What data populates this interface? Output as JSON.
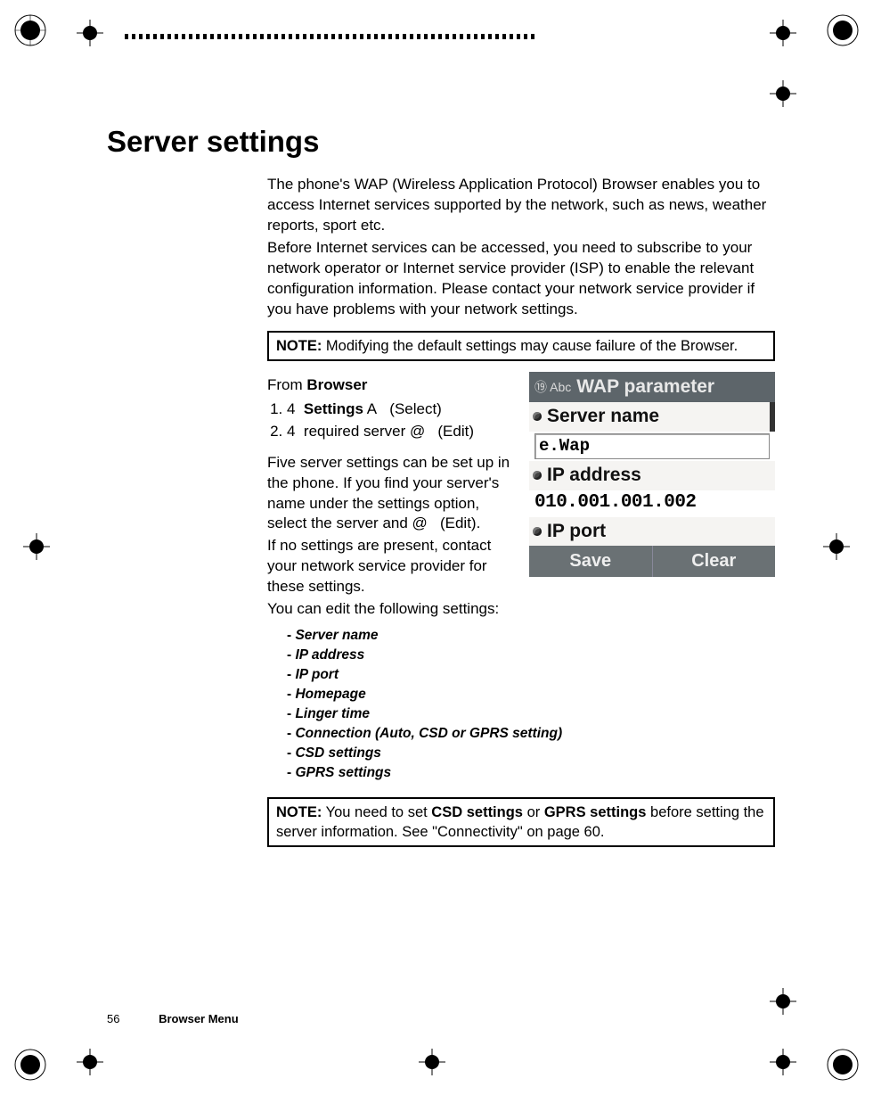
{
  "heading": "Server settings",
  "intro1": "The phone's WAP (Wireless Application Protocol) Browser enables you to access Internet services supported by the network, such as news, weather reports, sport etc.",
  "intro2": "Before Internet services can be accessed, you need to subscribe to your network operator or Internet service provider (ISP) to enable the relevant configuration information. Please contact your network service provider if you have problems with your network settings.",
  "note1_label": "NOTE:",
  "note1_text": " Modifying the default settings may cause failure of the Browser.",
  "from_prefix": "From ",
  "from_bold": "Browser",
  "step1_pre": "4",
  "step1_bold": "Settings",
  "step1_post": " A   (Select)",
  "step2_pre": "4",
  "step2_post": "  required server @   (Edit)",
  "mid1": "Five server settings can be set up in the phone. If you find your server's name under the settings option, select the server and @   (Edit).",
  "mid2": "If no settings are present, contact your network service provider for these settings.",
  "mid3": "You can edit the following settings:",
  "settings": {
    "s1": "Server name",
    "s2": "IP address",
    "s3": "IP port",
    "s4": "Homepage",
    "s5": "Linger time",
    "s6": "Connection (Auto, CSD or GPRS setting)",
    "s7": "CSD settings",
    "s8": "GPRS settings"
  },
  "note2_label": "NOTE:",
  "note2_a": " You need to set ",
  "note2_b1": "CSD settings",
  "note2_mid": " or ",
  "note2_b2": "GPRS settings",
  "note2_c": " before setting the server information. See \"Connectivity\" on page 60.",
  "footer_page": "56",
  "footer_section": "Browser Menu",
  "phone": {
    "title_small": "⑲ Abc",
    "title": "WAP parameter",
    "row1": "Server name",
    "input1": "e.Wap",
    "row2": "IP address",
    "val2": "010.001.001.002",
    "row3": "IP port",
    "soft_left": "Save",
    "soft_right": "Clear"
  }
}
